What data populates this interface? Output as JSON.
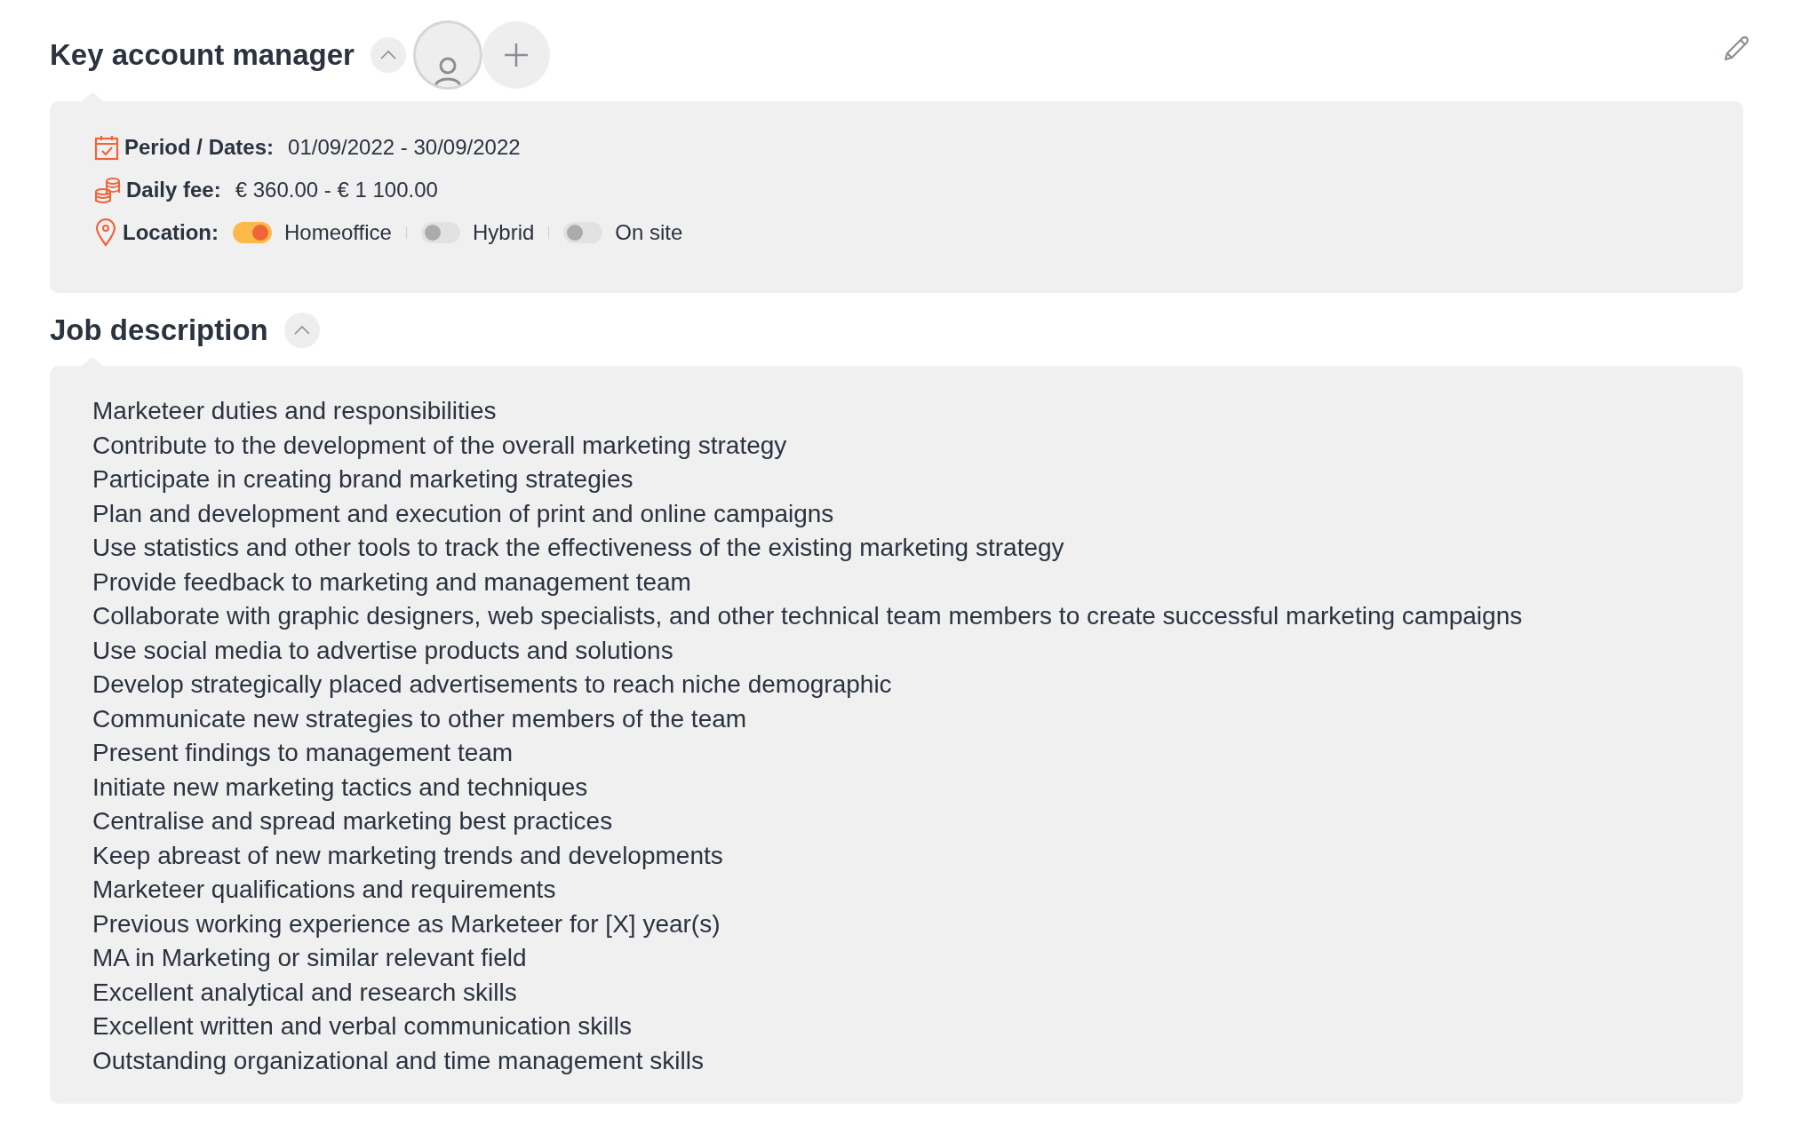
{
  "header": {
    "title": "Key account manager",
    "expanded": true
  },
  "details": {
    "period": {
      "label": "Period / Dates:",
      "value": "01/09/2022 - 30/09/2022"
    },
    "fee": {
      "label": "Daily fee:",
      "value": "€ 360.00 - € 1 100.00"
    },
    "location": {
      "label": "Location:",
      "options": [
        {
          "label": "Homeoffice",
          "on": true
        },
        {
          "label": "Hybrid",
          "on": false
        },
        {
          "label": "On site",
          "on": false
        }
      ]
    }
  },
  "job_description": {
    "title": "Job description",
    "expanded": true,
    "lines": [
      "Marketeer duties and responsibilities",
      "Contribute to the development of the overall marketing strategy",
      "Participate in creating brand marketing strategies",
      "Plan and development and execution of print and online campaigns",
      "Use statistics and other tools to track the effectiveness of the existing marketing strategy",
      "Provide feedback to marketing and management team",
      "Collaborate with graphic designers, web specialists, and other technical team members to create successful marketing campaigns",
      "Use social media to advertise products and solutions",
      "Develop strategically placed advertisements to reach niche demographic",
      "Communicate new strategies to other members of the team",
      "Present findings to management team",
      "Initiate new marketing tactics and techniques",
      "Centralise and spread marketing best practices",
      "Keep abreast of new marketing trends and developments",
      "Marketeer qualifications and requirements",
      "Previous working experience as Marketeer for [X] year(s)",
      "MA in Marketing or similar relevant field",
      "Excellent analytical and research skills",
      "Excellent written and verbal communication skills",
      "Outstanding organizational and time management skills"
    ]
  }
}
